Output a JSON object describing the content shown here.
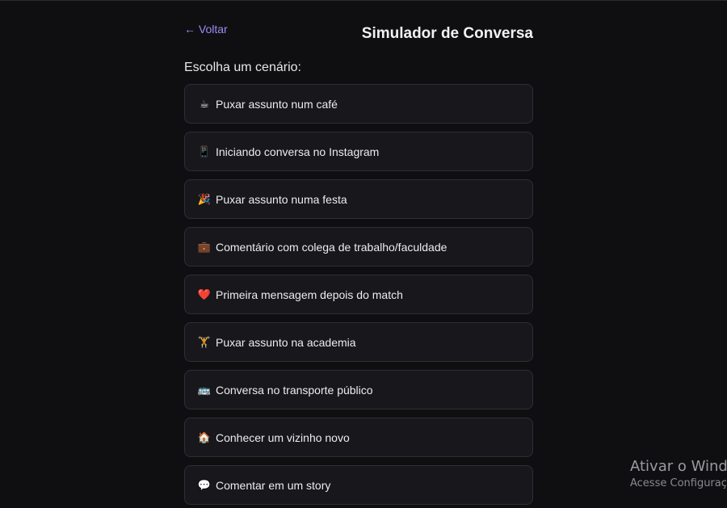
{
  "header": {
    "back_label": "← Voltar",
    "title": "Simulador de Conversa"
  },
  "subtitle": "Escolha um cenário:",
  "scenarios": [
    {
      "icon": "☕",
      "icon_name": "coffee-icon",
      "label": "Puxar assunto num café"
    },
    {
      "icon": "📱",
      "icon_name": "phone-icon",
      "label": "Iniciando conversa no Instagram"
    },
    {
      "icon": "🎉",
      "icon_name": "party-icon",
      "label": "Puxar assunto numa festa"
    },
    {
      "icon": "💼",
      "icon_name": "briefcase-icon",
      "label": "Comentário com colega de trabalho/faculdade"
    },
    {
      "icon": "❤️",
      "icon_name": "heart-icon",
      "label": "Primeira mensagem depois do match"
    },
    {
      "icon": "🏋",
      "icon_name": "weightlifter-icon",
      "label": "Puxar assunto na academia"
    },
    {
      "icon": "🚌",
      "icon_name": "bus-icon",
      "label": "Conversa no transporte público"
    },
    {
      "icon": "🏠",
      "icon_name": "house-icon",
      "label": "Conhecer um vizinho novo"
    },
    {
      "icon": "💬",
      "icon_name": "speech-bubble-icon",
      "label": "Comentar em um story"
    }
  ],
  "watermark": {
    "line1": "Ativar o Wind",
    "line2": "Acesse Configuraç"
  },
  "colors": {
    "background": "#0f0f12",
    "card": "#17171c",
    "card_border": "#2e2e35",
    "accent": "#9a8cf5"
  }
}
